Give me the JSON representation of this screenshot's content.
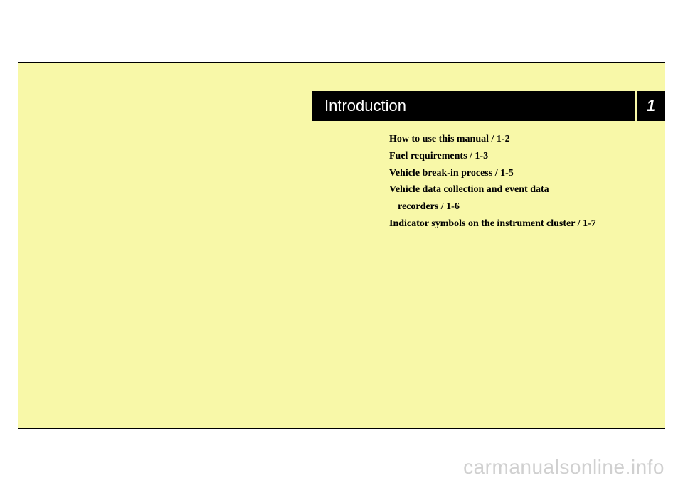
{
  "header": {
    "title": "Introduction",
    "chapter_number": "1"
  },
  "toc": {
    "items": [
      "How to use this manual / 1-2",
      "Fuel requirements / 1-3",
      "Vehicle break-in process / 1-5",
      "Vehicle data collection and event data",
      "recorders / 1-6",
      "Indicator symbols on the instrument cluster / 1-7"
    ]
  },
  "watermark": "carmanualsonline.info"
}
